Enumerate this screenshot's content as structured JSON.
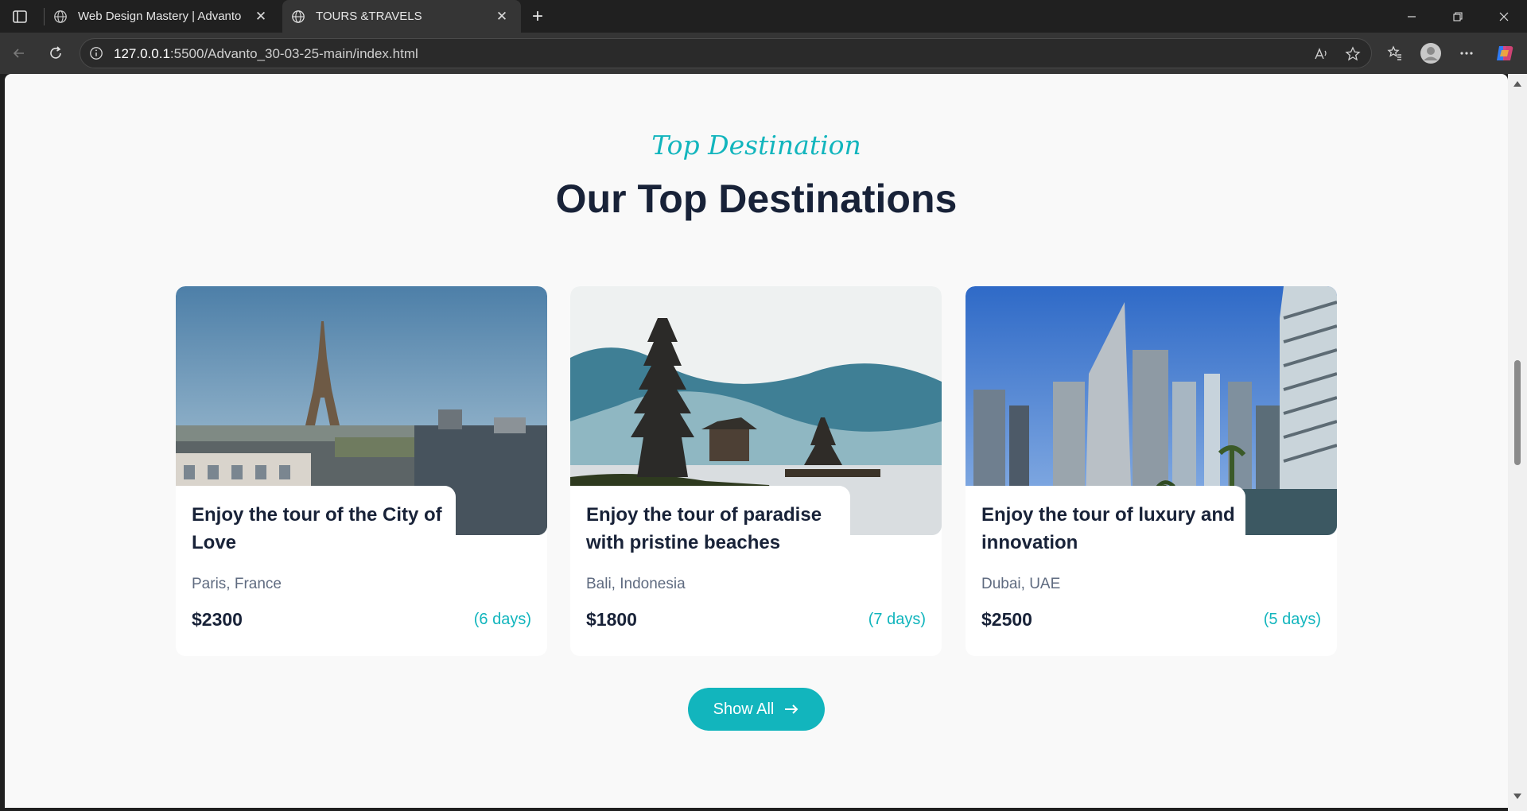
{
  "browser": {
    "tabs": [
      {
        "title": "Web Design Mastery | Advanto",
        "active": false
      },
      {
        "title": "TOURS &TRAVELS",
        "active": true
      }
    ],
    "url_host": "127.0.0.1",
    "url_rest": ":5500/Advanto_30-03-25-main/index.html"
  },
  "section": {
    "subtitle": "Top Destination",
    "heading": "Our Top Destinations"
  },
  "cards": [
    {
      "title": "Enjoy the tour of the City of Love",
      "location": "Paris, France",
      "price": "$2300",
      "duration": "(6 days)",
      "image": "eiffel-tower-photo"
    },
    {
      "title": "Enjoy the tour of paradise with pristine beaches",
      "location": "Bali, Indonesia",
      "price": "$1800",
      "duration": "(7 days)",
      "image": "bali-temple-photo"
    },
    {
      "title": "Enjoy the tour of luxury and innovation",
      "location": "Dubai, UAE",
      "price": "$2500",
      "duration": "(5 days)",
      "image": "dubai-skyline-photo"
    }
  ],
  "cta": {
    "label": "Show All"
  },
  "colors": {
    "accent": "#12b5bd",
    "heading": "#182238",
    "muted": "#5f6b80",
    "page_bg": "#f9f9f9",
    "chrome_bg": "#202020"
  }
}
